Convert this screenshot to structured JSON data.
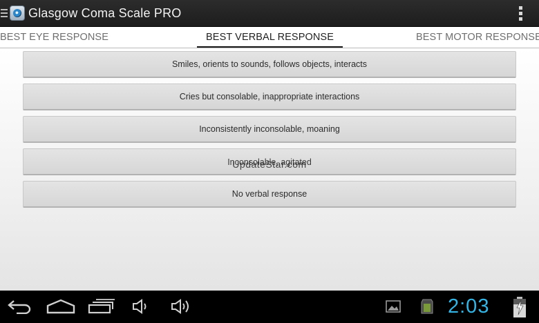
{
  "app": {
    "title": "Glasgow Coma Scale PRO"
  },
  "tabs": [
    {
      "label": "BEST EYE RESPONSE",
      "selected": false
    },
    {
      "label": "BEST VERBAL RESPONSE",
      "selected": true
    },
    {
      "label": "BEST MOTOR RESPONSE",
      "selected": false
    }
  ],
  "options": [
    {
      "label": "Smiles, orients to sounds, follows objects, interacts"
    },
    {
      "label": "Cries but consolable, inappropriate interactions"
    },
    {
      "label": "Inconsistently inconsolable, moaning"
    },
    {
      "label": "Inconsolable, agitated"
    },
    {
      "label": "No verbal response"
    }
  ],
  "watermark": "UpdateStar.com",
  "system_bar": {
    "clock": "2:03",
    "icons": [
      "back-icon",
      "home-icon",
      "recent-apps-icon",
      "volume-down-icon",
      "volume-up-icon",
      "gallery-notification-icon",
      "sd-card-notification-icon",
      "battery-charging-icon"
    ]
  },
  "colors": {
    "action_bar": "#1d1d1d",
    "clock": "#33b5e5",
    "tab_indicator": "#1a1a1a",
    "option_background": "#dcdcdc"
  }
}
